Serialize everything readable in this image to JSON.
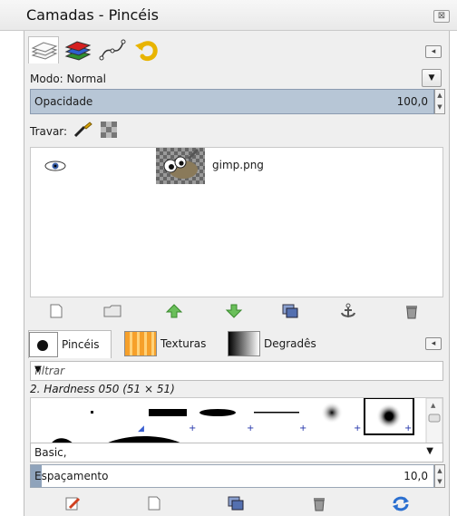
{
  "window": {
    "title": "Camadas - Pincéis",
    "close_glyph": "⊠"
  },
  "layers_panel": {
    "tab_icons": [
      "layers-icon",
      "channels-icon",
      "paths-icon",
      "undo-history-icon"
    ],
    "mode_label": "Modo: Normal",
    "opacity_label": "Opacidade",
    "opacity_value": "100,0",
    "lock_label": "Travar:",
    "layers": [
      {
        "name": "gimp.png",
        "visible": true
      }
    ],
    "toolbar_icons": [
      "new-layer-icon",
      "new-layer-group-icon",
      "raise-layer-icon",
      "lower-layer-icon",
      "duplicate-layer-icon",
      "anchor-layer-icon",
      "delete-layer-icon"
    ]
  },
  "brushes_panel": {
    "tabs": [
      {
        "label": "Pincéis",
        "active": true
      },
      {
        "label": "Texturas",
        "active": false
      },
      {
        "label": "Degradês",
        "active": false
      }
    ],
    "filter_placeholder": "filtrar",
    "selected_brush": "2. Hardness 050 (51 × 51)",
    "brush_set": "Basic,",
    "spacing_label": "Espaçamento",
    "spacing_value": "10,0",
    "toolbar_icons": [
      "edit-brush-icon",
      "new-brush-icon",
      "duplicate-brush-icon",
      "delete-brush-icon",
      "refresh-brushes-icon"
    ]
  },
  "colors": {
    "accent": "#b7c6d6",
    "panel_bg": "#efefef"
  }
}
